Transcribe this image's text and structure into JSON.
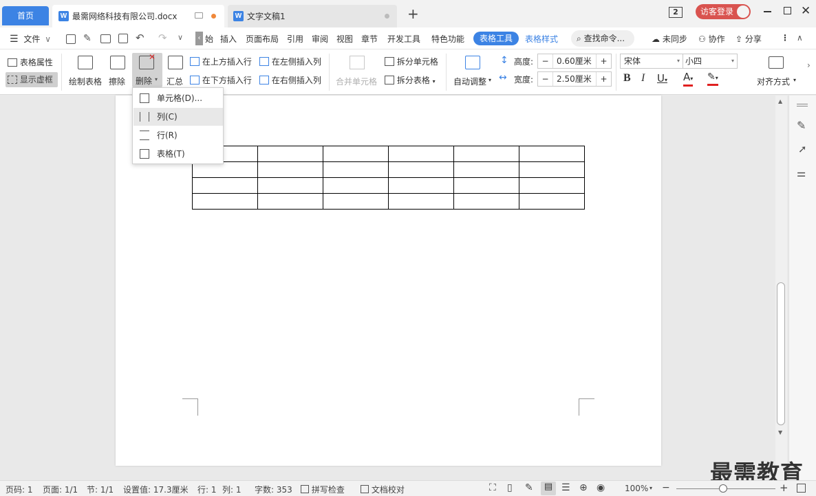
{
  "tabs": {
    "home": "首页",
    "doc1": "最需网络科技有限公司.docx",
    "doc2": "文字文稿1",
    "new_tab": "+"
  },
  "window": {
    "badge": "2",
    "login": "访客登录"
  },
  "menu": {
    "file": "文件",
    "items": [
      "始",
      "插入",
      "页面布局",
      "引用",
      "审阅",
      "视图",
      "章节",
      "开发工具",
      "特色功能"
    ],
    "table_tools": "表格工具",
    "table_style": "表格样式",
    "search": "查找命令...",
    "sync": "未同步",
    "collab": "协作",
    "share": "分享"
  },
  "ribbon": {
    "table_props": "表格属性",
    "show_grid": "显示虚框",
    "draw_table": "绘制表格",
    "erase": "擦除",
    "delete": "删除",
    "summary": "汇总",
    "insert_above": "在上方插入行",
    "insert_below": "在下方插入行",
    "insert_left": "在左侧插入列",
    "insert_right": "在右侧插入列",
    "merge_cells": "合并单元格",
    "split_cells": "拆分单元格",
    "split_table": "拆分表格",
    "auto_adjust": "自动调整",
    "height_label": "高度:",
    "height_value": "0.60厘米",
    "width_label": "宽度:",
    "width_value": "2.50厘米",
    "font_name": "宋体",
    "font_size": "小四",
    "align": "对齐方式"
  },
  "dropdown": {
    "items": [
      "单元格(D)...",
      "列(C)",
      "行(R)",
      "表格(T)"
    ],
    "highlighted": 1
  },
  "status": {
    "page": "页码: 1",
    "pages": "页面: 1/1",
    "section": "节: 1/1",
    "setting": "设置值: 17.3厘米",
    "row": "行: 1",
    "col": "列: 1",
    "words": "字数: 353",
    "spell": "拼写检查",
    "proof": "文档校对",
    "zoom": "100%"
  },
  "watermark": "最需教育",
  "colors": {
    "accent": "#3c83e4",
    "login_bg": "#d9534f"
  }
}
